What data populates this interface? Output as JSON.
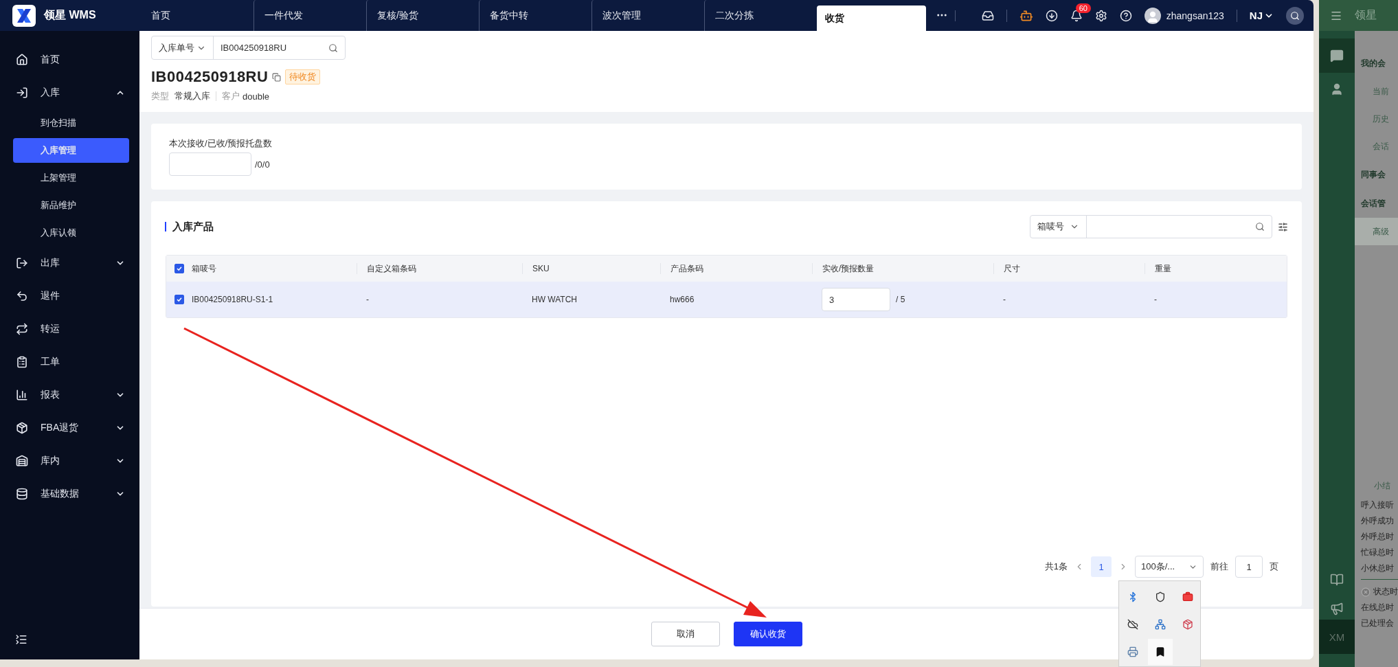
{
  "brand": {
    "name": "领星 WMS"
  },
  "tabs": [
    {
      "label": "首页",
      "selected": false
    },
    {
      "label": "一件代发",
      "selected": false
    },
    {
      "label": "复核/验货",
      "selected": false
    },
    {
      "label": "备货中转",
      "selected": false
    },
    {
      "label": "波次管理",
      "selected": false
    },
    {
      "label": "二次分拣",
      "selected": false
    },
    {
      "label": "收货",
      "selected": true
    }
  ],
  "header": {
    "notifications": "60",
    "user": "zhangsan123",
    "warehouse": "NJ"
  },
  "sidebar": {
    "items": [
      {
        "label": "首页",
        "selected": false
      },
      {
        "label": "入库",
        "selected": false,
        "expanded": true,
        "children": [
          {
            "label": "到仓扫描",
            "selected": false
          },
          {
            "label": "入库管理",
            "selected": true
          },
          {
            "label": "上架管理",
            "selected": false
          },
          {
            "label": "新品维护",
            "selected": false
          },
          {
            "label": "入库认领",
            "selected": false
          }
        ]
      },
      {
        "label": "出库",
        "selected": false,
        "expanded": false
      },
      {
        "label": "退件",
        "selected": false
      },
      {
        "label": "转运",
        "selected": false
      },
      {
        "label": "工单",
        "selected": false
      },
      {
        "label": "报表",
        "selected": false,
        "expanded": false
      },
      {
        "label": "FBA退货",
        "selected": false,
        "expanded": false
      },
      {
        "label": "库内",
        "selected": false,
        "expanded": false
      },
      {
        "label": "基础数据",
        "selected": false,
        "expanded": false
      }
    ]
  },
  "search": {
    "filter": "入库单号",
    "value": "IB004250918RU"
  },
  "order": {
    "number": "IB004250918RU",
    "status": "待收货",
    "type_label": "类型",
    "type": "常规入库",
    "customer_label": "客户",
    "customer": "double"
  },
  "pallets": {
    "label": "本次接收/已收/预报托盘数",
    "suffix": "/0/0"
  },
  "products": {
    "title": "入库产品",
    "filter": "箱唛号",
    "all_checked": true,
    "columns": [
      "箱唛号",
      "自定义箱条码",
      "SKU",
      "产品条码",
      "实收/预报数量",
      "尺寸",
      "重量"
    ],
    "rows": [
      {
        "checked": true,
        "box": "IB004250918RU-S1-1",
        "custom_code": "-",
        "sku": "HW WATCH",
        "barcode": "hw666",
        "received": "3",
        "expected": "/ 5",
        "size": "-",
        "weight": "-"
      }
    ]
  },
  "pagination": {
    "total": "共1条",
    "pages": [
      {
        "label": "1",
        "selected": true
      }
    ],
    "page_size": "100条/...",
    "goto_label": "前往",
    "goto_value": "1",
    "page_suffix": "页"
  },
  "footer": {
    "buttons": [
      {
        "label": "取消",
        "kind": "secondary"
      },
      {
        "label": "确认收货",
        "kind": "primary"
      }
    ]
  },
  "chat_panel": {
    "logo": "领星",
    "menu": [
      {
        "label": "我的会",
        "kind": "group",
        "selected": false
      },
      {
        "label": "当前",
        "kind": "item",
        "selected": false
      },
      {
        "label": "历史",
        "kind": "item",
        "selected": false
      },
      {
        "label": "会话",
        "kind": "item",
        "selected": false
      },
      {
        "label": "同事会",
        "kind": "group",
        "selected": false
      },
      {
        "label": "会话管",
        "kind": "group",
        "selected": false
      },
      {
        "label": "高级",
        "kind": "item",
        "selected": true
      }
    ],
    "summary_title": "小结",
    "summary": [
      "呼入接听",
      "外呼成功",
      "外呼总时",
      "忙碌总时",
      "小休总时"
    ],
    "status": [
      "状态时",
      "在线总时",
      "已处理会"
    ],
    "footer": "XM"
  }
}
